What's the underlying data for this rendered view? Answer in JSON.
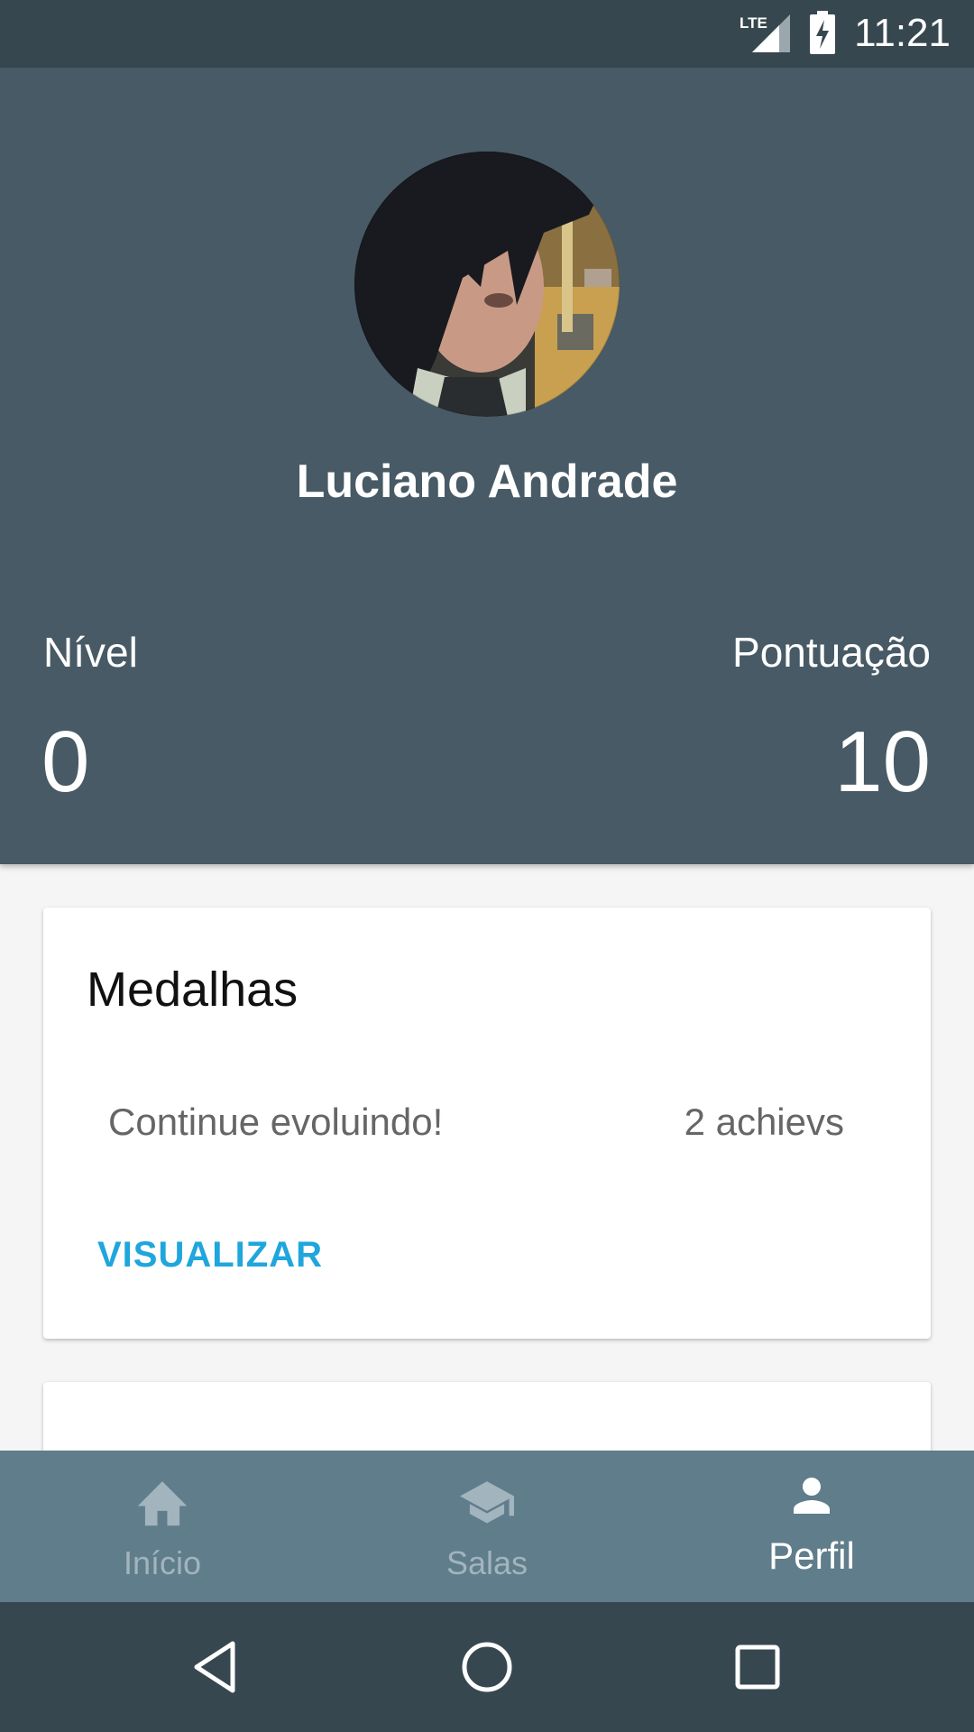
{
  "status_bar": {
    "time": "11:21",
    "network": "LTE",
    "icons": [
      "lte-signal-icon",
      "battery-charging-icon"
    ]
  },
  "profile": {
    "name": "Luciano Andrade",
    "avatar": "profile-photo"
  },
  "stats": {
    "level_label": "Nível",
    "level_value": "0",
    "score_label": "Pontuação",
    "score_value": "10"
  },
  "medals_card": {
    "title": "Medalhas",
    "message": "Continue evoluindo!",
    "count": "2 achievs",
    "action": "VISUALIZAR"
  },
  "bottom_nav": {
    "items": [
      {
        "label": "Início",
        "icon": "home-icon",
        "active": false
      },
      {
        "label": "Salas",
        "icon": "school-icon",
        "active": false
      },
      {
        "label": "Perfil",
        "icon": "person-icon",
        "active": true
      }
    ]
  },
  "system_nav": {
    "buttons": [
      "back-icon",
      "home-circle-icon",
      "recents-icon"
    ]
  },
  "colors": {
    "status_bar": "#37474f",
    "header": "#475a65",
    "bottom_nav": "#607d8b",
    "accent": "#1fa6dc",
    "background": "#f5f5f5",
    "nav_inactive": "#a2b4be"
  }
}
